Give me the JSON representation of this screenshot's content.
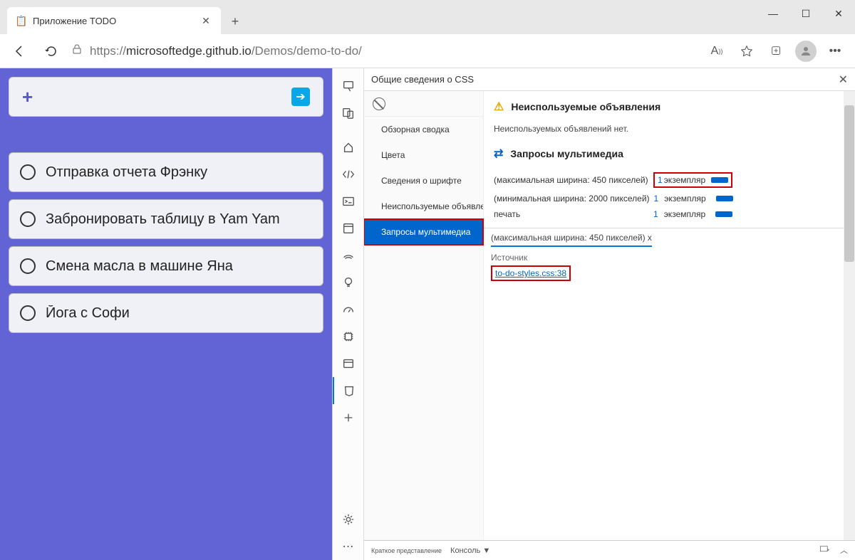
{
  "tab_title": "Приложение TODO",
  "url_prefix": "https://",
  "url_host": "microsoftedge.github.io",
  "url_path": "/Demos/demo-to-do/",
  "todos": [
    "Отправка отчета Фрэнку",
    "Забронировать таблицу в Yam Yam",
    "Смена масла в машине Яна",
    "Йога с Софи"
  ],
  "panel_title": "Общие сведения о CSS",
  "nav": {
    "overview": "Обзорная сводка",
    "colors": "Цвета",
    "fonts": "Сведения о шрифте",
    "unused": "Неиспользуемые объявления",
    "media": "Запросы мультимедиа"
  },
  "sections": {
    "unused_hdr": "Неиспользуемые объявления",
    "unused_body": "Неиспользуемых объявлений нет.",
    "media_hdr": "Запросы мультимедиа"
  },
  "mq": [
    {
      "label": "(максимальная ширина: 450 пикселей)",
      "count": "1",
      "inst": "экземпляр"
    },
    {
      "label": "(минимальная ширина: 2000 пикселей)",
      "count": "1",
      "inst": "экземпляр"
    },
    {
      "label": "печать",
      "count": "1",
      "inst": "экземпляр"
    }
  ],
  "detail_tab": "(максимальная ширина: 450 пикселей) x",
  "source_label": "Источник",
  "source_link": "to-do-styles.css:38",
  "drawer_left": "Краткое представление",
  "drawer_console": "Консоль"
}
